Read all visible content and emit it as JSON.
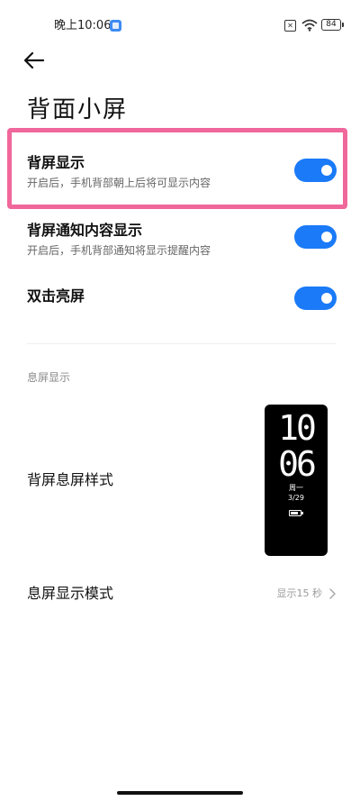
{
  "status_bar": {
    "time": "晚上10:06",
    "sim": "✕",
    "battery": "84"
  },
  "page": {
    "title": "背面小屏"
  },
  "settings": [
    {
      "title": "背屏显示",
      "desc": "开启后，手机背部朝上后将可显示内容",
      "enabled": true
    },
    {
      "title": "背屏通知内容显示",
      "desc": "开启后，手机背部通知将显示提醒内容",
      "enabled": true
    },
    {
      "title": "双击亮屏",
      "desc": "",
      "enabled": true
    }
  ],
  "aod": {
    "section_label": "息屏显示",
    "style_label": "背屏息屏样式",
    "preview": {
      "hour": "10",
      "minute": "06",
      "weekday": "周一",
      "date": "3/29"
    },
    "mode_label": "息屏显示模式",
    "mode_value": "显示15 秒"
  },
  "colors": {
    "accent": "#1a7af8",
    "highlight": "#f0679b"
  }
}
